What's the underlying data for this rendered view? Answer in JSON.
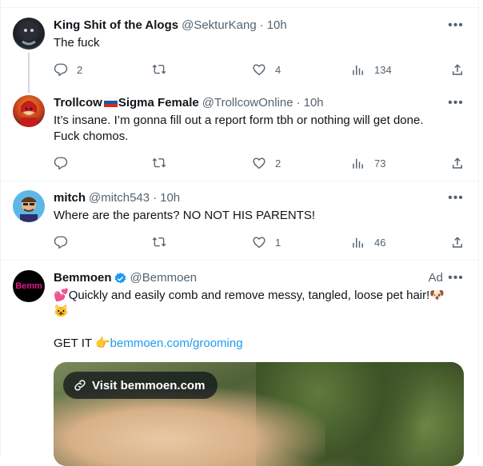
{
  "tweets": [
    {
      "name": "King Shit of the Alogs",
      "handle": "@SekturKang",
      "time": "10h",
      "text": "The fuck",
      "replies": "2",
      "retweets": "",
      "likes": "4",
      "views": "134"
    },
    {
      "name_before_flag": "Trollcow",
      "name_after_flag": "Sigma Female",
      "handle": "@TrollcowOnline",
      "time": "10h",
      "text": "It’s insane. I’m gonna fill out a report form tbh or nothing will get done. Fuck chomos.",
      "replies": "",
      "retweets": "",
      "likes": "2",
      "views": "73"
    },
    {
      "name": "mitch",
      "handle": "@mitch543",
      "time": "10h",
      "text": "Where are the parents? NO NOT HIS PARENTS!",
      "replies": "",
      "retweets": "",
      "likes": "1",
      "views": "46"
    }
  ],
  "ad": {
    "name": "Bemmoen",
    "handle": "@Bemmoen",
    "avatar_text": "Bemm",
    "ad_label": "Ad",
    "line1_emoji_start": "💕",
    "line1": "Quickly and easily comb and remove messy, tangled, loose pet hair!",
    "line1_emoji_end": "🐶",
    "line2_emoji": "😺",
    "cta_text": "GET IT ",
    "cta_emoji": "👉",
    "cta_link": "bemmoen.com/grooming",
    "visit_label": "Visit bemmoen.com"
  },
  "colors": {
    "link": "#1d9bf0",
    "secondary_text": "#536471",
    "verified": "#1d9bf0"
  }
}
